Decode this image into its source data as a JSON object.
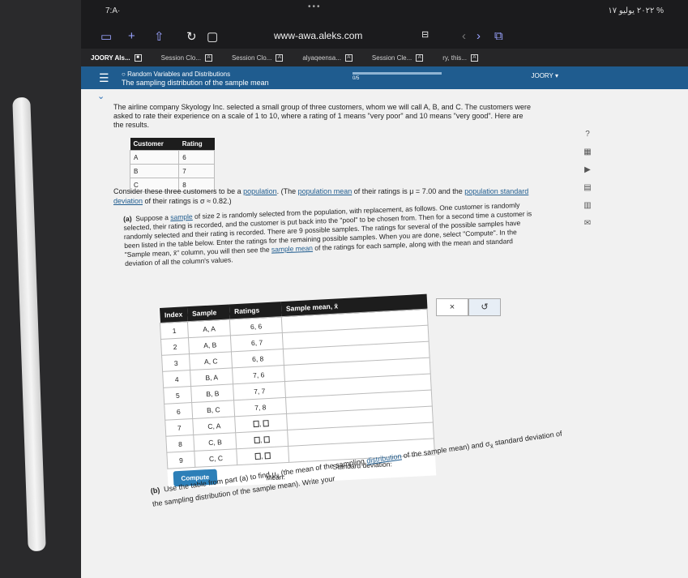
{
  "status": {
    "left": "7:A·",
    "dots": "•••",
    "right": "٢٠٢٢ يوليو ١٧ %"
  },
  "browser": {
    "url": "www-awa.aleks.com",
    "lock_icon": "lock-icon"
  },
  "tabs": [
    {
      "label": "JOORY Als...",
      "active": true
    },
    {
      "label": "Session Clo...",
      "active": false
    },
    {
      "label": "Session Clo...",
      "active": false
    },
    {
      "label": "alyaqeensa...",
      "active": false
    },
    {
      "label": "Session Cle...",
      "active": false
    },
    {
      "label": "ry, this...",
      "active": false
    }
  ],
  "aleks": {
    "topic": "Random Variables and Distributions",
    "subtopic": "The sampling distribution of the sample mean",
    "progress": "0/5",
    "user": "JOORY"
  },
  "problem": {
    "intro": "The airline company Skyology Inc. selected a small group of three customers, whom we will call A, B, and C. The customers were asked to rate their experience on a scale of 1 to 10, where a rating of 1 means \"very poor\" and 10 means \"very good\". Here are the results.",
    "customer_table": {
      "headers": [
        "Customer",
        "Rating"
      ],
      "rows": [
        [
          "A",
          "6"
        ],
        [
          "B",
          "7"
        ],
        [
          "C",
          "8"
        ]
      ]
    },
    "consider_1": "Consider these three customers to be a ",
    "consider_link1": "population",
    "consider_2": ". (The ",
    "consider_link2": "population mean",
    "consider_3": " of their ratings is μ = 7.00 and the ",
    "consider_link3": "population standard deviation",
    "consider_4": " of their ratings is σ ≈ 0.82.)",
    "part_a_label": "(a)",
    "part_a_1": "Suppose a ",
    "part_a_link": "sample",
    "part_a_2": " of size 2 is randomly selected from the population, with replacement, as follows. One customer is randomly selected, their rating is recorded, and the customer is put back into the \"pool\" to be chosen from. Then for a second time a customer is randomly selected and their rating is recorded. There are 9 possible samples. The ratings for several of the possible samples have been listed in the table below. Enter the ratings for the remaining possible samples. When you are done, select \"Compute\". In the \"Sample mean, x̄\" column, you will then see the ",
    "part_a_link2": "sample mean",
    "part_a_3": " of the ratings for each sample, along with the mean and standard deviation of all the column's values.",
    "sample_table": {
      "headers": [
        "Index",
        "Sample",
        "Ratings",
        "Sample mean, x̄"
      ],
      "rows": [
        [
          "1",
          "A, A",
          "6, 6"
        ],
        [
          "2",
          "A, B",
          "6, 7"
        ],
        [
          "3",
          "A, C",
          "6, 8"
        ],
        [
          "4",
          "B, A",
          "7, 6"
        ],
        [
          "5",
          "B, B",
          "7, 7"
        ],
        [
          "6",
          "B, C",
          "7, 8"
        ],
        [
          "7",
          "C, A",
          ""
        ],
        [
          "8",
          "C, B",
          ""
        ],
        [
          "9",
          "C, C",
          ""
        ]
      ],
      "mean_label": "Mean:",
      "sd_label": "Standard deviation:",
      "compute_label": "Compute"
    },
    "tools": {
      "clear": "×",
      "undo": "↺"
    },
    "part_b_label": "(b)",
    "part_b_1": "Use the table from part (a) to find μ",
    "part_b_sub": "x̄",
    "part_b_2": " (the mean of the sampling ",
    "part_b_link": "distribution",
    "part_b_3": " of the sample mean) and σ",
    "part_b_4": " standard deviation of the sampling distribution of the sample mean). Write your"
  }
}
